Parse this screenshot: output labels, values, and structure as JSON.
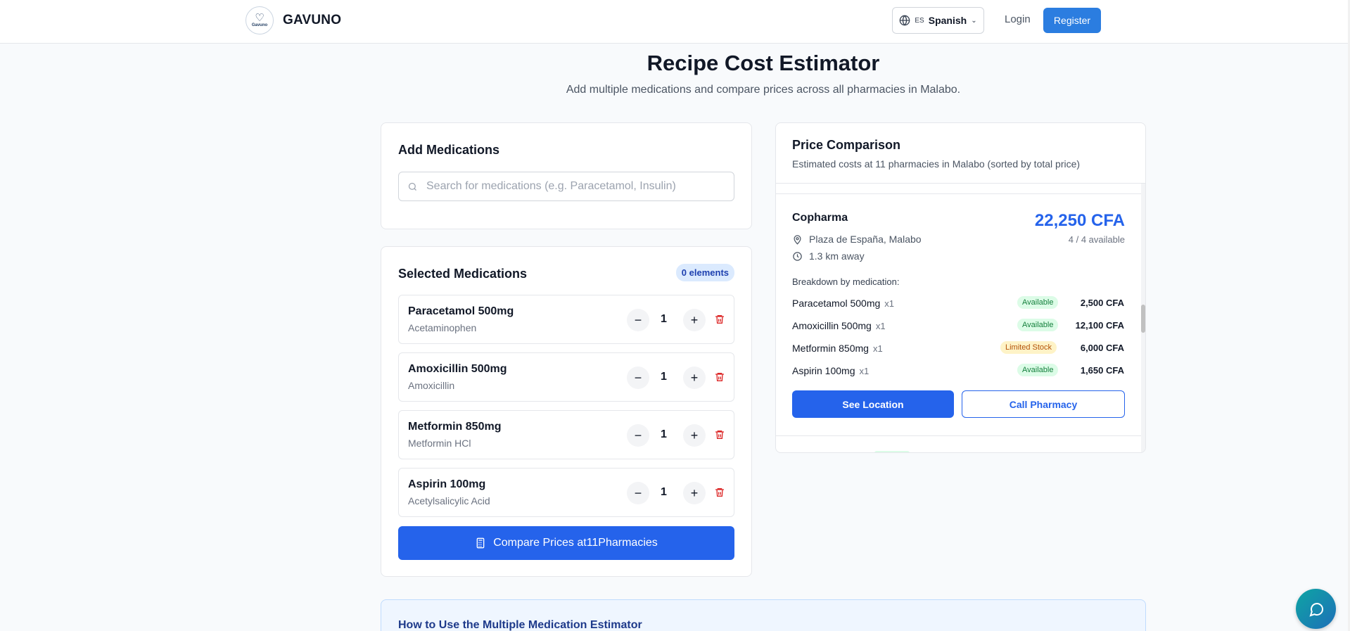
{
  "header": {
    "logo_text": "Gavuno",
    "brand_name": "GAVUNO",
    "language": {
      "code": "ES",
      "name": "Spanish"
    },
    "login_label": "Login",
    "register_label": "Register"
  },
  "page": {
    "title": "Recipe Cost Estimator",
    "subtitle": "Add multiple medications and compare prices across all pharmacies in Malabo."
  },
  "add_medications": {
    "title": "Add Medications",
    "search_placeholder": "Search for medications (e.g. Paracetamol, Insulin)"
  },
  "selected": {
    "title": "Selected Medications",
    "count_badge": "0 elements",
    "items": [
      {
        "name": "Paracetamol 500mg",
        "generic": "Acetaminophen",
        "qty": "1"
      },
      {
        "name": "Amoxicillin 500mg",
        "generic": "Amoxicillin",
        "qty": "1"
      },
      {
        "name": "Metformin 850mg",
        "generic": "Metformin HCl",
        "qty": "1"
      },
      {
        "name": "Aspirin 100mg",
        "generic": "Acetylsalicylic Acid",
        "qty": "1"
      }
    ],
    "compare_label": "Compare Prices at11Pharmacies"
  },
  "price_comparison": {
    "title": "Price Comparison",
    "subtitle": "Estimated costs at 11 pharmacies in Malabo (sorted by total price)",
    "pharmacy": {
      "name": "Copharma",
      "total": "22,250 CFA",
      "availability": "4 / 4 available",
      "address": "Plaza de España, Malabo",
      "distance": "1.3 km away",
      "breakdown_label": "Breakdown by medication:",
      "breakdown": [
        {
          "name": "Paracetamol 500mg",
          "qty": "x1",
          "status": "Available",
          "price": "2,500 CFA"
        },
        {
          "name": "Amoxicillin 500mg",
          "qty": "x1",
          "status": "Available",
          "price": "12,100 CFA"
        },
        {
          "name": "Metformin 850mg",
          "qty": "x1",
          "status": "Limited Stock",
          "price": "6,000 CFA"
        },
        {
          "name": "Aspirin 100mg",
          "qty": "x1",
          "status": "Available",
          "price": "1,650 CFA"
        }
      ],
      "see_location_label": "See Location",
      "call_label": "Call Pharmacy"
    }
  },
  "howto": {
    "title": "How to Use the Multiple Medication Estimator"
  },
  "colors": {
    "primary": "#2563eb",
    "register": "#2b7de0",
    "available": "#15803d",
    "limited": "#b45309",
    "danger": "#dc2626"
  },
  "icons": {
    "globe": "globe-icon",
    "search": "search-icon",
    "minus": "minus-icon",
    "plus": "plus-icon",
    "trash": "trash-icon",
    "calculator": "calculator-icon",
    "map_pin": "map-pin-icon",
    "clock": "clock-icon",
    "chat": "chat-icon"
  }
}
